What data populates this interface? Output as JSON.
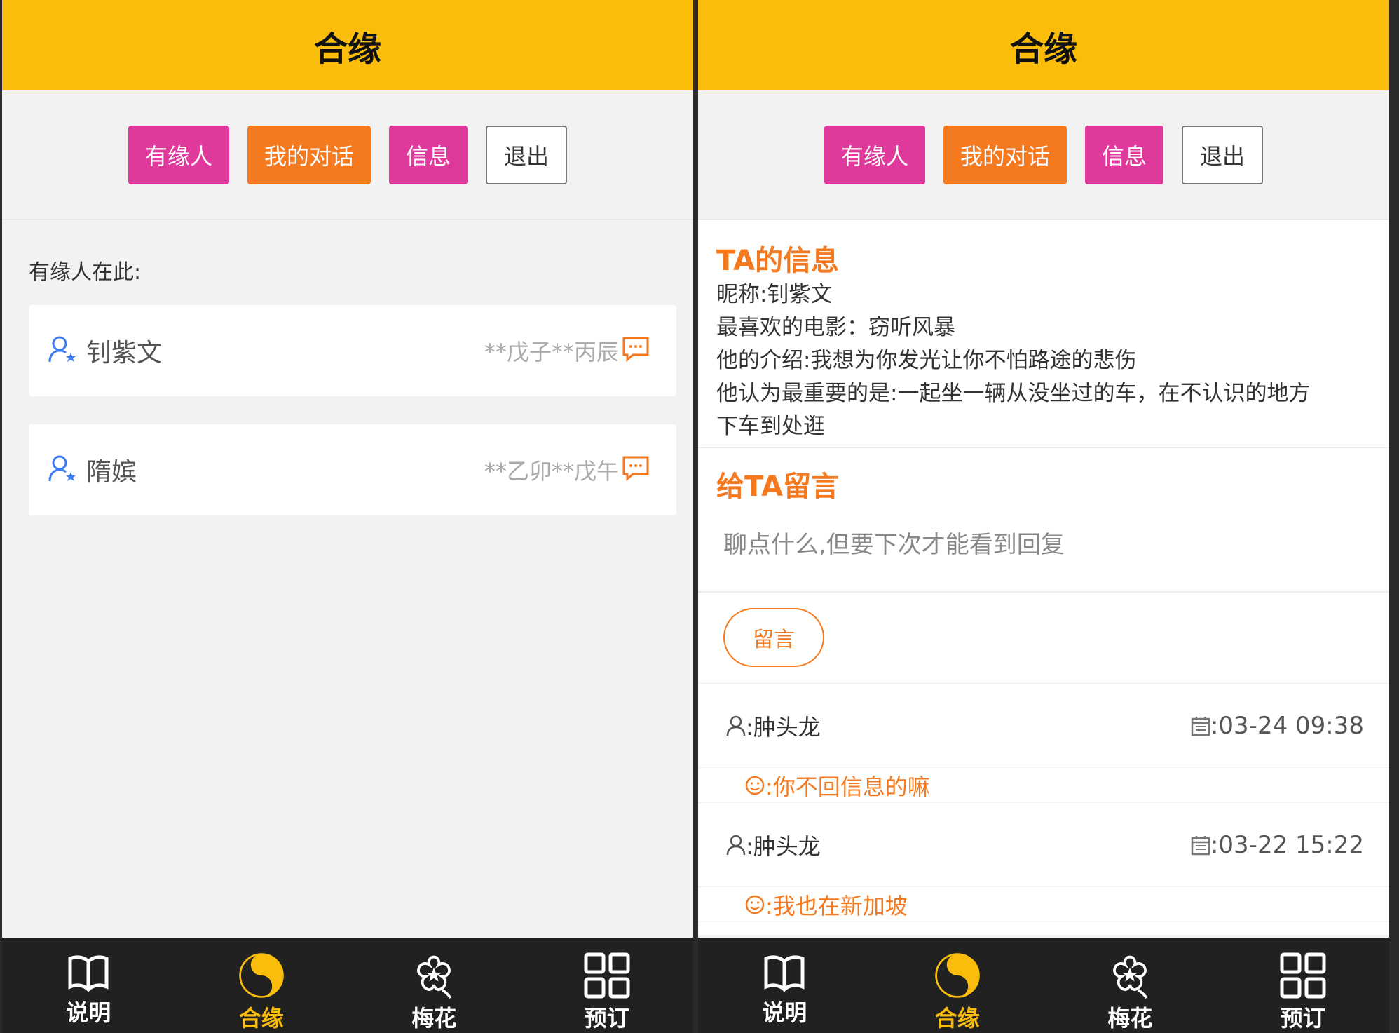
{
  "colors": {
    "header": "#fbbd0b",
    "pink": "#e0399c",
    "orange": "#f5791e",
    "tabbar": "#212121"
  },
  "left": {
    "title": "合缘",
    "buttons": [
      "有缘人",
      "我的对话",
      "信息",
      "退出"
    ],
    "list_title": "有缘人在此:",
    "matches": [
      {
        "name": "钊紫文",
        "bazi": "**戊子**丙辰"
      },
      {
        "name": "隋嫔",
        "bazi": "**乙卯**戊午"
      }
    ],
    "tabs": [
      "说明",
      "合缘",
      "梅花",
      "预订"
    ]
  },
  "right": {
    "title": "合缘",
    "buttons": [
      "有缘人",
      "我的对话",
      "信息",
      "退出"
    ],
    "info_title": "TA的信息",
    "info_lines": [
      "昵称:钊紫文",
      "最喜欢的电影：窃听风暴",
      "他的介绍:我想为你发光让你不怕路途的悲伤",
      "他认为最重要的是:一起坐一辆从没坐过的车，在不认识的地方",
      "下车到处逛"
    ],
    "msg_title": "给TA留言",
    "msg_placeholder": "聊点什么,但要下次才能看到回复",
    "leave_btn": "留言",
    "comments": [
      {
        "user": ":肿头龙",
        "time": ":03-24 09:38",
        "text": ":你不回信息的嘛"
      },
      {
        "user": ":肿头龙",
        "time": ":03-22 15:22",
        "text": ":我也在新加坡"
      }
    ],
    "tabs": [
      "说明",
      "合缘",
      "梅花",
      "预订"
    ]
  }
}
